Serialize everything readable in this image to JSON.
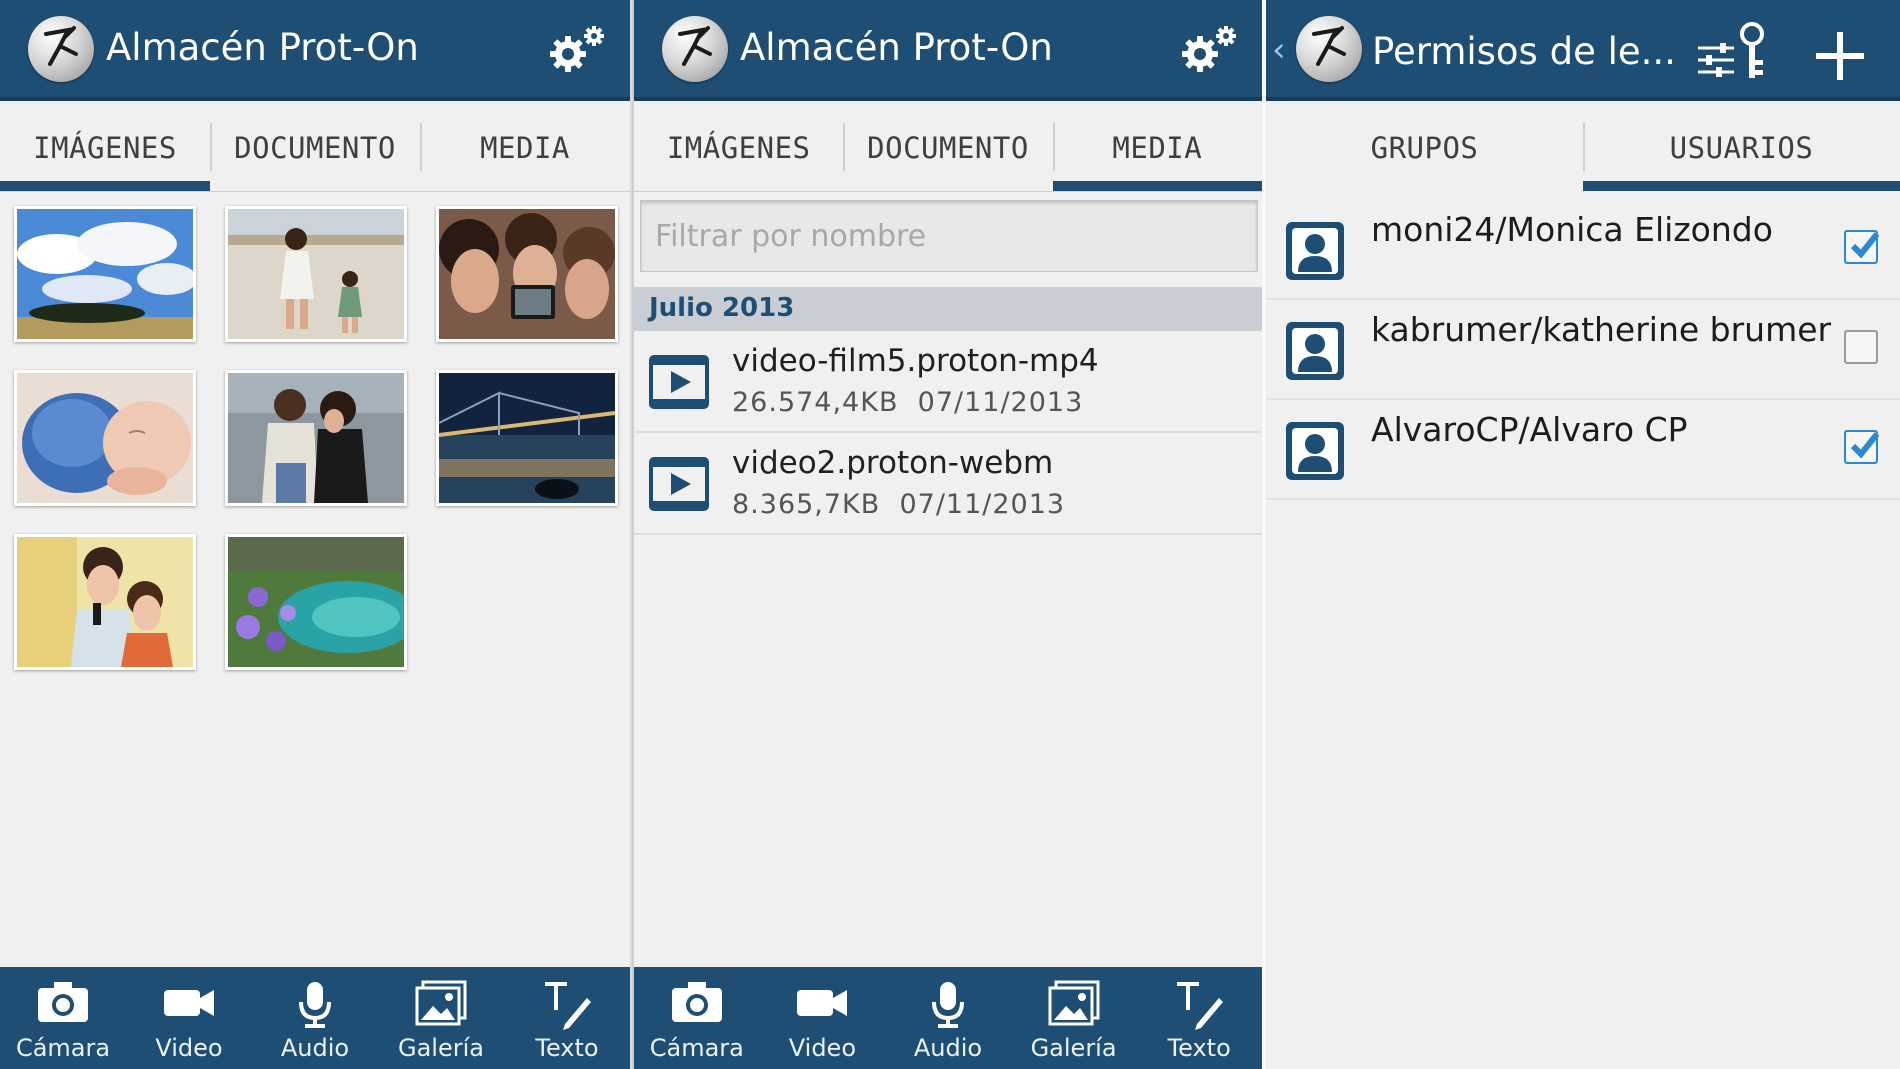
{
  "colors": {
    "accent": "#1e4e73",
    "checkbox": "#2a8ad1"
  },
  "panels": [
    {
      "app_title": "Almacén Prot-On",
      "settings_icon": "gear-icon",
      "tabs": [
        {
          "label": "IMÁGENES",
          "active": true
        },
        {
          "label": "DOCUMENTO",
          "active": false
        },
        {
          "label": "MEDIA",
          "active": false
        }
      ],
      "thumbnails": [
        "sky-clouds-tree",
        "mother-child-beach",
        "friends-selfie",
        "sleeping-baby",
        "couple-embrace",
        "bridge-night",
        "couple-microphone",
        "coastal-cove"
      ],
      "toolbar": [
        {
          "label": "Cámara",
          "icon": "camera-icon"
        },
        {
          "label": "Video",
          "icon": "video-camera-icon"
        },
        {
          "label": "Audio",
          "icon": "microphone-icon"
        },
        {
          "label": "Galería",
          "icon": "gallery-icon"
        },
        {
          "label": "Texto",
          "icon": "text-pen-icon"
        }
      ]
    },
    {
      "app_title": "Almacén Prot-On",
      "settings_icon": "gear-icon",
      "tabs": [
        {
          "label": "IMÁGENES",
          "active": false
        },
        {
          "label": "DOCUMENTO",
          "active": false
        },
        {
          "label": "MEDIA",
          "active": true
        }
      ],
      "filter_placeholder": "Filtrar por nombre",
      "section_header": "Julio 2013",
      "files": [
        {
          "name": "video-film5.proton-mp4",
          "size": "26.574,4KB",
          "date": "07/11/2013"
        },
        {
          "name": "video2.proton-webm",
          "size": "8.365,7KB",
          "date": "07/11/2013"
        }
      ],
      "toolbar": [
        {
          "label": "Cámara",
          "icon": "camera-icon"
        },
        {
          "label": "Video",
          "icon": "video-camera-icon"
        },
        {
          "label": "Audio",
          "icon": "microphone-icon"
        },
        {
          "label": "Galería",
          "icon": "gallery-icon"
        },
        {
          "label": "Texto",
          "icon": "text-pen-icon"
        }
      ]
    },
    {
      "app_title": "Permisos de le...",
      "back_icon": "chevron-left-icon",
      "actions": [
        "permissions-key-icon",
        "add-icon"
      ],
      "tabs": [
        {
          "label": "GRUPOS",
          "active": false
        },
        {
          "label": "USUARIOS",
          "active": true
        }
      ],
      "users": [
        {
          "name": "moni24/Monica Elizondo",
          "checked": true
        },
        {
          "name": "kabrumer/katherine brumer",
          "checked": false
        },
        {
          "name": "AlvaroCP/Alvaro CP",
          "checked": true
        }
      ]
    }
  ]
}
